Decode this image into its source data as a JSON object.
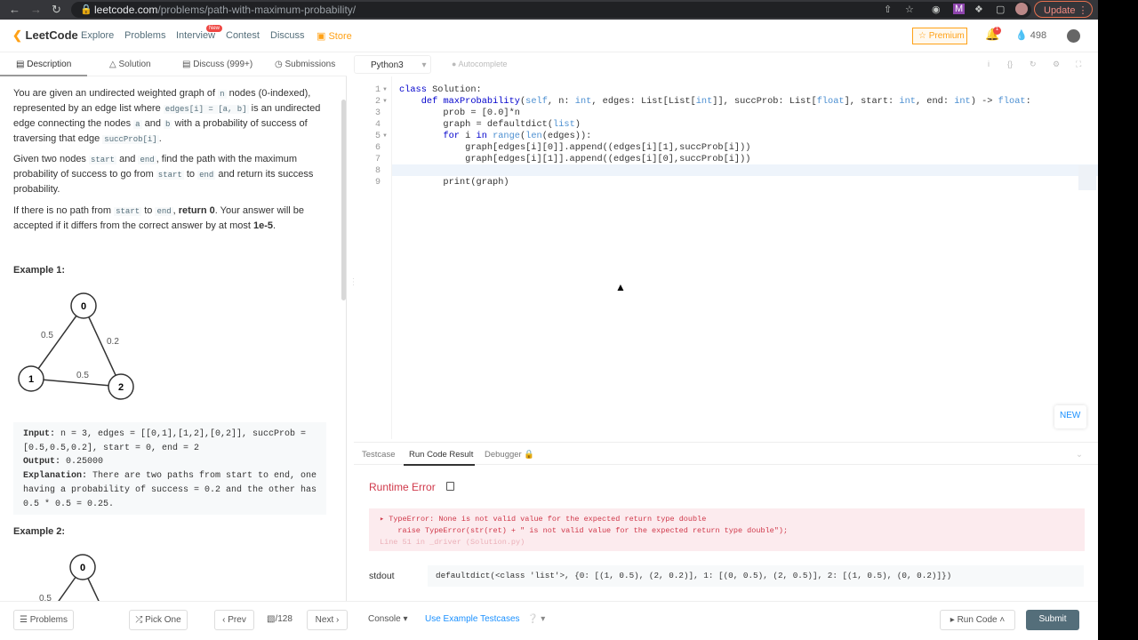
{
  "browser": {
    "url_domain": "leetcode.com",
    "url_path": "/problems/path-with-maximum-probability/",
    "update_label": "Update"
  },
  "nav": {
    "logo": "LeetCode",
    "items": [
      "Explore",
      "Problems",
      "Interview",
      "Contest",
      "Discuss",
      "Store"
    ],
    "new_badge": "New",
    "premium": "Premium",
    "notifications": "1",
    "coins": "498"
  },
  "tabs": [
    "Description",
    "Solution",
    "Discuss (999+)",
    "Submissions"
  ],
  "problem": {
    "p1": [
      "You are given an undirected weighted graph of ",
      "n",
      " nodes (0-indexed), represented by an edge list where ",
      "edges[i] = [a, b]",
      " is an undirected edge connecting the nodes ",
      "a",
      " and ",
      "b",
      " with a probability of success of traversing that edge ",
      "succProb[i]",
      "."
    ],
    "p2": [
      "Given two nodes ",
      "start",
      " and ",
      "end",
      ", find the path with the maximum probability of success to go from ",
      "start",
      " to ",
      "end",
      " and return its success probability."
    ],
    "p3": [
      "If there is no path from ",
      "start",
      " to ",
      "end",
      ", ",
      "return 0",
      ". Your answer will be accepted if it differs from the correct answer by at most ",
      "1e-5",
      "."
    ],
    "example1_title": "Example 1:",
    "example2_title": "Example 2:",
    "example1": {
      "input_label": "Input:",
      "input": " n = 3, edges = [[0,1],[1,2],[0,2]], succProb =",
      "input2": "[0.5,0.5,0.2], start = 0, end = 2",
      "output_label": "Output:",
      "output": " 0.25000",
      "expl_label": "Explanation:",
      "expl": " There are two paths from start to end, one",
      "expl2": "having a probability of success = 0.2 and the other has",
      "expl3": "0.5 * 0.5 = 0.25."
    },
    "graph1": {
      "nodes": [
        "0",
        "1",
        "2"
      ],
      "edge_labels": [
        "0.5",
        "0.2",
        "0.5"
      ]
    },
    "graph2": {
      "nodes": [
        "0"
      ],
      "edge_labels": [
        "0.5"
      ]
    }
  },
  "editor": {
    "language": "Python3",
    "autocomplete": "Autocomplete",
    "line_numbers": [
      "1",
      "2",
      "3",
      "4",
      "5",
      "6",
      "7",
      "8",
      "9"
    ]
  },
  "result": {
    "tabs": [
      "Testcase",
      "Run Code Result",
      "Debugger"
    ],
    "title": "Runtime Error",
    "err1": "TypeError: None is not valid value for the expected return type double",
    "err2": "    raise TypeError(str(ret) + \" is not valid value for the expected return type double\");",
    "err3": "Line 51 in _driver (Solution.py)",
    "stdout_label": "stdout",
    "stdout": "defaultdict(<class 'list'>, {0: [(1, 0.5), (2, 0.2)], 1: [(0, 0.5), (2, 0.5)], 2: [(1, 0.5), (0, 0.2)]})"
  },
  "new_button": "NEW",
  "footer": {
    "problems": "Problems",
    "pick_one": "Pick One",
    "prev": "Prev",
    "page": "/128",
    "next": "Next",
    "console": "Console",
    "use_example": "Use Example Testcases",
    "run_code": "Run Code",
    "submit": "Submit"
  }
}
